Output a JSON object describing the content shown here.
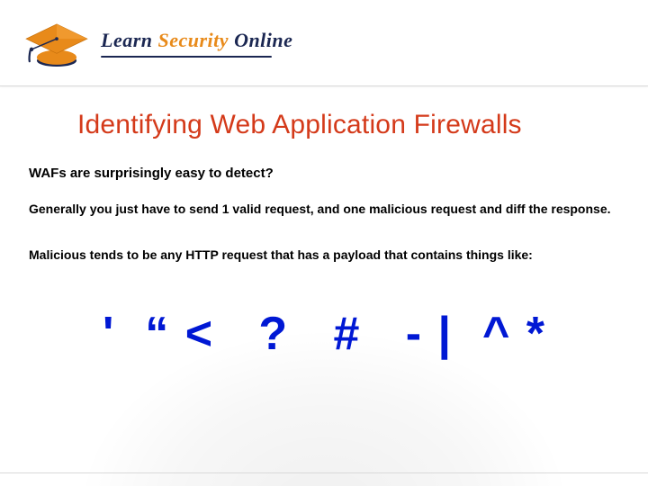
{
  "brand": {
    "word1": "Learn",
    "word2": "Security",
    "word3": "Online",
    "cap_color": "#e88a1a",
    "cap_shadow": "#1b2752"
  },
  "slide": {
    "title": "Identifying Web Application Firewalls",
    "para1": "WAFs are surprisingly easy to detect?",
    "para2": "Generally you just have to send 1 valid request, and one malicious request and diff the response.",
    "para3": "Malicious tends to be any HTTP request that has a payload that contains things like:",
    "symbols": "'  “ <   ?   #   - |  ^ *"
  },
  "colors": {
    "title": "#d43a1a",
    "symbols": "#0018d4"
  }
}
